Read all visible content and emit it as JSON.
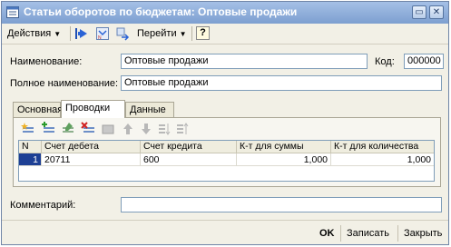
{
  "window": {
    "title": "Статьи оборотов по бюджетам: Оптовые продажи",
    "controls": {
      "restore": "▭",
      "close": "✕"
    }
  },
  "toolbar": {
    "actions": "Действия",
    "goto": "Перейти",
    "help": "?"
  },
  "form": {
    "name_label": "Наименование:",
    "name_value": "Оптовые продажи",
    "code_label": "Код:",
    "code_value": "000000",
    "full_name_label": "Полное наименование:",
    "full_name_value": "Оптовые продажи",
    "comment_label": "Комментарий:",
    "comment_value": ""
  },
  "tabs": [
    {
      "label": "Основная",
      "active": false
    },
    {
      "label": "Проводки",
      "active": true
    },
    {
      "label": "Данные",
      "active": false
    }
  ],
  "grid": {
    "columns": [
      "N",
      "Счет дебета",
      "Счет кредита",
      "К-т для суммы",
      "К-т для количества"
    ],
    "rows": [
      {
        "n": "1",
        "debit": "20711",
        "credit": "600",
        "sum_k": "1,000",
        "qty_k": "1,000"
      }
    ]
  },
  "buttons": {
    "ok": "OK",
    "save": "Записать",
    "close": "Закрыть"
  },
  "colors": {
    "title_bar": "#7d9fd0",
    "selection": "#1d3f94",
    "window_bg": "#f2f0e6"
  }
}
